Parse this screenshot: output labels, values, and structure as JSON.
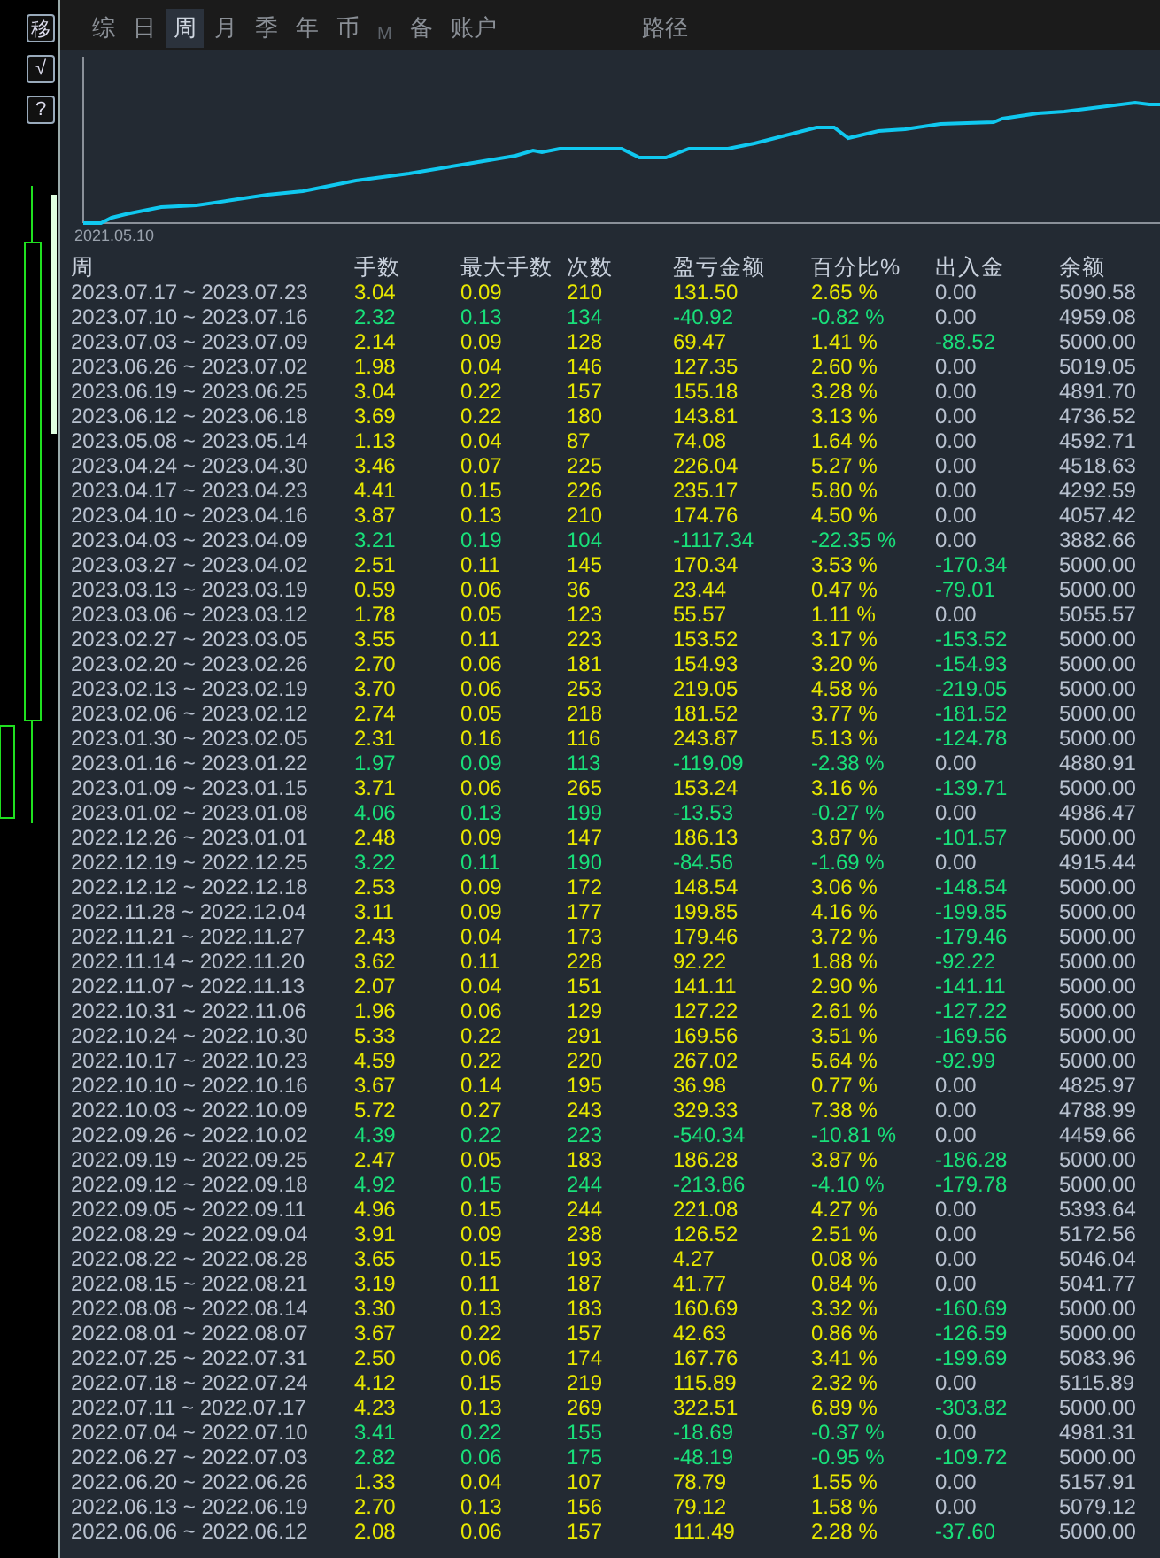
{
  "side_buttons": [
    "移",
    "√",
    "?"
  ],
  "tabs": [
    {
      "label": "综",
      "selected": false,
      "disabled": false
    },
    {
      "label": "日",
      "selected": false,
      "disabled": false
    },
    {
      "label": "周",
      "selected": true,
      "disabled": false
    },
    {
      "label": "月",
      "selected": false,
      "disabled": false
    },
    {
      "label": "季",
      "selected": false,
      "disabled": false
    },
    {
      "label": "年",
      "selected": false,
      "disabled": false
    },
    {
      "label": "币",
      "selected": false,
      "disabled": false
    },
    {
      "label": "M",
      "selected": false,
      "disabled": true
    },
    {
      "label": "备",
      "selected": false,
      "disabled": false
    },
    {
      "label": "账户",
      "selected": false,
      "disabled": false
    }
  ],
  "path_tab": "路径",
  "equity_chart": {
    "start_label": "2021.05.10"
  },
  "table": {
    "columns": [
      "周",
      "手数",
      "最大手数",
      "次数",
      "盈亏金额",
      "百分比%",
      "出入金",
      "余额"
    ],
    "rows": [
      {
        "cells": [
          "2023.07.17 ~ 2023.07.23",
          "3.04",
          "0.09",
          "210",
          "131.50",
          "2.65 %",
          "0.00",
          "5090.58"
        ],
        "loss": false,
        "withdrawal": false
      },
      {
        "cells": [
          "2023.07.10 ~ 2023.07.16",
          "2.32",
          "0.13",
          "134",
          "-40.92",
          "-0.82 %",
          "0.00",
          "4959.08"
        ],
        "loss": true,
        "withdrawal": false
      },
      {
        "cells": [
          "2023.07.03 ~ 2023.07.09",
          "2.14",
          "0.09",
          "128",
          "69.47",
          "1.41 %",
          "-88.52",
          "5000.00"
        ],
        "loss": false,
        "withdrawal": true
      },
      {
        "cells": [
          "2023.06.26 ~ 2023.07.02",
          "1.98",
          "0.04",
          "146",
          "127.35",
          "2.60 %",
          "0.00",
          "5019.05"
        ],
        "loss": false,
        "withdrawal": false
      },
      {
        "cells": [
          "2023.06.19 ~ 2023.06.25",
          "3.04",
          "0.22",
          "157",
          "155.18",
          "3.28 %",
          "0.00",
          "4891.70"
        ],
        "loss": false,
        "withdrawal": false
      },
      {
        "cells": [
          "2023.06.12 ~ 2023.06.18",
          "3.69",
          "0.22",
          "180",
          "143.81",
          "3.13 %",
          "0.00",
          "4736.52"
        ],
        "loss": false,
        "withdrawal": false
      },
      {
        "cells": [
          "2023.05.08 ~ 2023.05.14",
          "1.13",
          "0.04",
          "87",
          "74.08",
          "1.64 %",
          "0.00",
          "4592.71"
        ],
        "loss": false,
        "withdrawal": false
      },
      {
        "cells": [
          "2023.04.24 ~ 2023.04.30",
          "3.46",
          "0.07",
          "225",
          "226.04",
          "5.27 %",
          "0.00",
          "4518.63"
        ],
        "loss": false,
        "withdrawal": false
      },
      {
        "cells": [
          "2023.04.17 ~ 2023.04.23",
          "4.41",
          "0.15",
          "226",
          "235.17",
          "5.80 %",
          "0.00",
          "4292.59"
        ],
        "loss": false,
        "withdrawal": false
      },
      {
        "cells": [
          "2023.04.10 ~ 2023.04.16",
          "3.87",
          "0.13",
          "210",
          "174.76",
          "4.50 %",
          "0.00",
          "4057.42"
        ],
        "loss": false,
        "withdrawal": false
      },
      {
        "cells": [
          "2023.04.03 ~ 2023.04.09",
          "3.21",
          "0.19",
          "104",
          "-1117.34",
          "-22.35 %",
          "0.00",
          "3882.66"
        ],
        "loss": true,
        "withdrawal": false
      },
      {
        "cells": [
          "2023.03.27 ~ 2023.04.02",
          "2.51",
          "0.11",
          "145",
          "170.34",
          "3.53 %",
          "-170.34",
          "5000.00"
        ],
        "loss": false,
        "withdrawal": true
      },
      {
        "cells": [
          "2023.03.13 ~ 2023.03.19",
          "0.59",
          "0.06",
          "36",
          "23.44",
          "0.47 %",
          "-79.01",
          "5000.00"
        ],
        "loss": false,
        "withdrawal": true
      },
      {
        "cells": [
          "2023.03.06 ~ 2023.03.12",
          "1.78",
          "0.05",
          "123",
          "55.57",
          "1.11 %",
          "0.00",
          "5055.57"
        ],
        "loss": false,
        "withdrawal": false
      },
      {
        "cells": [
          "2023.02.27 ~ 2023.03.05",
          "3.55",
          "0.11",
          "223",
          "153.52",
          "3.17 %",
          "-153.52",
          "5000.00"
        ],
        "loss": false,
        "withdrawal": true
      },
      {
        "cells": [
          "2023.02.20 ~ 2023.02.26",
          "2.70",
          "0.06",
          "181",
          "154.93",
          "3.20 %",
          "-154.93",
          "5000.00"
        ],
        "loss": false,
        "withdrawal": true
      },
      {
        "cells": [
          "2023.02.13 ~ 2023.02.19",
          "3.70",
          "0.06",
          "253",
          "219.05",
          "4.58 %",
          "-219.05",
          "5000.00"
        ],
        "loss": false,
        "withdrawal": true
      },
      {
        "cells": [
          "2023.02.06 ~ 2023.02.12",
          "2.74",
          "0.05",
          "218",
          "181.52",
          "3.77 %",
          "-181.52",
          "5000.00"
        ],
        "loss": false,
        "withdrawal": true
      },
      {
        "cells": [
          "2023.01.30 ~ 2023.02.05",
          "2.31",
          "0.16",
          "116",
          "243.87",
          "5.13 %",
          "-124.78",
          "5000.00"
        ],
        "loss": false,
        "withdrawal": true
      },
      {
        "cells": [
          "2023.01.16 ~ 2023.01.22",
          "1.97",
          "0.09",
          "113",
          "-119.09",
          "-2.38 %",
          "0.00",
          "4880.91"
        ],
        "loss": true,
        "withdrawal": false
      },
      {
        "cells": [
          "2023.01.09 ~ 2023.01.15",
          "3.71",
          "0.06",
          "265",
          "153.24",
          "3.16 %",
          "-139.71",
          "5000.00"
        ],
        "loss": false,
        "withdrawal": true
      },
      {
        "cells": [
          "2023.01.02 ~ 2023.01.08",
          "4.06",
          "0.13",
          "199",
          "-13.53",
          "-0.27 %",
          "0.00",
          "4986.47"
        ],
        "loss": true,
        "withdrawal": false
      },
      {
        "cells": [
          "2022.12.26 ~ 2023.01.01",
          "2.48",
          "0.09",
          "147",
          "186.13",
          "3.87 %",
          "-101.57",
          "5000.00"
        ],
        "loss": false,
        "withdrawal": true
      },
      {
        "cells": [
          "2022.12.19 ~ 2022.12.25",
          "3.22",
          "0.11",
          "190",
          "-84.56",
          "-1.69 %",
          "0.00",
          "4915.44"
        ],
        "loss": true,
        "withdrawal": false
      },
      {
        "cells": [
          "2022.12.12 ~ 2022.12.18",
          "2.53",
          "0.09",
          "172",
          "148.54",
          "3.06 %",
          "-148.54",
          "5000.00"
        ],
        "loss": false,
        "withdrawal": true
      },
      {
        "cells": [
          "2022.11.28 ~ 2022.12.04",
          "3.11",
          "0.09",
          "177",
          "199.85",
          "4.16 %",
          "-199.85",
          "5000.00"
        ],
        "loss": false,
        "withdrawal": true
      },
      {
        "cells": [
          "2022.11.21 ~ 2022.11.27",
          "2.43",
          "0.04",
          "173",
          "179.46",
          "3.72 %",
          "-179.46",
          "5000.00"
        ],
        "loss": false,
        "withdrawal": true
      },
      {
        "cells": [
          "2022.11.14 ~ 2022.11.20",
          "3.62",
          "0.11",
          "228",
          "92.22",
          "1.88 %",
          "-92.22",
          "5000.00"
        ],
        "loss": false,
        "withdrawal": true
      },
      {
        "cells": [
          "2022.11.07 ~ 2022.11.13",
          "2.07",
          "0.04",
          "151",
          "141.11",
          "2.90 %",
          "-141.11",
          "5000.00"
        ],
        "loss": false,
        "withdrawal": true
      },
      {
        "cells": [
          "2022.10.31 ~ 2022.11.06",
          "1.96",
          "0.06",
          "129",
          "127.22",
          "2.61 %",
          "-127.22",
          "5000.00"
        ],
        "loss": false,
        "withdrawal": true
      },
      {
        "cells": [
          "2022.10.24 ~ 2022.10.30",
          "5.33",
          "0.22",
          "291",
          "169.56",
          "3.51 %",
          "-169.56",
          "5000.00"
        ],
        "loss": false,
        "withdrawal": true
      },
      {
        "cells": [
          "2022.10.17 ~ 2022.10.23",
          "4.59",
          "0.22",
          "220",
          "267.02",
          "5.64 %",
          "-92.99",
          "5000.00"
        ],
        "loss": false,
        "withdrawal": true
      },
      {
        "cells": [
          "2022.10.10 ~ 2022.10.16",
          "3.67",
          "0.14",
          "195",
          "36.98",
          "0.77 %",
          "0.00",
          "4825.97"
        ],
        "loss": false,
        "withdrawal": false
      },
      {
        "cells": [
          "2022.10.03 ~ 2022.10.09",
          "5.72",
          "0.27",
          "243",
          "329.33",
          "7.38 %",
          "0.00",
          "4788.99"
        ],
        "loss": false,
        "withdrawal": false
      },
      {
        "cells": [
          "2022.09.26 ~ 2022.10.02",
          "4.39",
          "0.22",
          "223",
          "-540.34",
          "-10.81 %",
          "0.00",
          "4459.66"
        ],
        "loss": true,
        "withdrawal": false
      },
      {
        "cells": [
          "2022.09.19 ~ 2022.09.25",
          "2.47",
          "0.05",
          "183",
          "186.28",
          "3.87 %",
          "-186.28",
          "5000.00"
        ],
        "loss": false,
        "withdrawal": true
      },
      {
        "cells": [
          "2022.09.12 ~ 2022.09.18",
          "4.92",
          "0.15",
          "244",
          "-213.86",
          "-4.10 %",
          "-179.78",
          "5000.00"
        ],
        "loss": true,
        "withdrawal": true
      },
      {
        "cells": [
          "2022.09.05 ~ 2022.09.11",
          "4.96",
          "0.15",
          "244",
          "221.08",
          "4.27 %",
          "0.00",
          "5393.64"
        ],
        "loss": false,
        "withdrawal": false
      },
      {
        "cells": [
          "2022.08.29 ~ 2022.09.04",
          "3.91",
          "0.09",
          "238",
          "126.52",
          "2.51 %",
          "0.00",
          "5172.56"
        ],
        "loss": false,
        "withdrawal": false
      },
      {
        "cells": [
          "2022.08.22 ~ 2022.08.28",
          "3.65",
          "0.15",
          "193",
          "4.27",
          "0.08 %",
          "0.00",
          "5046.04"
        ],
        "loss": false,
        "withdrawal": false
      },
      {
        "cells": [
          "2022.08.15 ~ 2022.08.21",
          "3.19",
          "0.11",
          "187",
          "41.77",
          "0.84 %",
          "0.00",
          "5041.77"
        ],
        "loss": false,
        "withdrawal": false
      },
      {
        "cells": [
          "2022.08.08 ~ 2022.08.14",
          "3.30",
          "0.13",
          "183",
          "160.69",
          "3.32 %",
          "-160.69",
          "5000.00"
        ],
        "loss": false,
        "withdrawal": true
      },
      {
        "cells": [
          "2022.08.01 ~ 2022.08.07",
          "3.67",
          "0.22",
          "157",
          "42.63",
          "0.86 %",
          "-126.59",
          "5000.00"
        ],
        "loss": false,
        "withdrawal": true
      },
      {
        "cells": [
          "2022.07.25 ~ 2022.07.31",
          "2.50",
          "0.06",
          "174",
          "167.76",
          "3.41 %",
          "-199.69",
          "5083.96"
        ],
        "loss": false,
        "withdrawal": true
      },
      {
        "cells": [
          "2022.07.18 ~ 2022.07.24",
          "4.12",
          "0.15",
          "219",
          "115.89",
          "2.32 %",
          "0.00",
          "5115.89"
        ],
        "loss": false,
        "withdrawal": false
      },
      {
        "cells": [
          "2022.07.11 ~ 2022.07.17",
          "4.23",
          "0.13",
          "269",
          "322.51",
          "6.89 %",
          "-303.82",
          "5000.00"
        ],
        "loss": false,
        "withdrawal": true
      },
      {
        "cells": [
          "2022.07.04 ~ 2022.07.10",
          "3.41",
          "0.22",
          "155",
          "-18.69",
          "-0.37 %",
          "0.00",
          "4981.31"
        ],
        "loss": true,
        "withdrawal": false
      },
      {
        "cells": [
          "2022.06.27 ~ 2022.07.03",
          "2.82",
          "0.06",
          "175",
          "-48.19",
          "-0.95 %",
          "-109.72",
          "5000.00"
        ],
        "loss": true,
        "withdrawal": true
      },
      {
        "cells": [
          "2022.06.20 ~ 2022.06.26",
          "1.33",
          "0.04",
          "107",
          "78.79",
          "1.55 %",
          "0.00",
          "5157.91"
        ],
        "loss": false,
        "withdrawal": false
      },
      {
        "cells": [
          "2022.06.13 ~ 2022.06.19",
          "2.70",
          "0.13",
          "156",
          "79.12",
          "1.58 %",
          "0.00",
          "5079.12"
        ],
        "loss": false,
        "withdrawal": false
      },
      {
        "cells": [
          "2022.06.06 ~ 2022.06.12",
          "2.08",
          "0.06",
          "157",
          "111.49",
          "2.28 %",
          "-37.60",
          "5000.00"
        ],
        "loss": false,
        "withdrawal": true
      }
    ]
  }
}
